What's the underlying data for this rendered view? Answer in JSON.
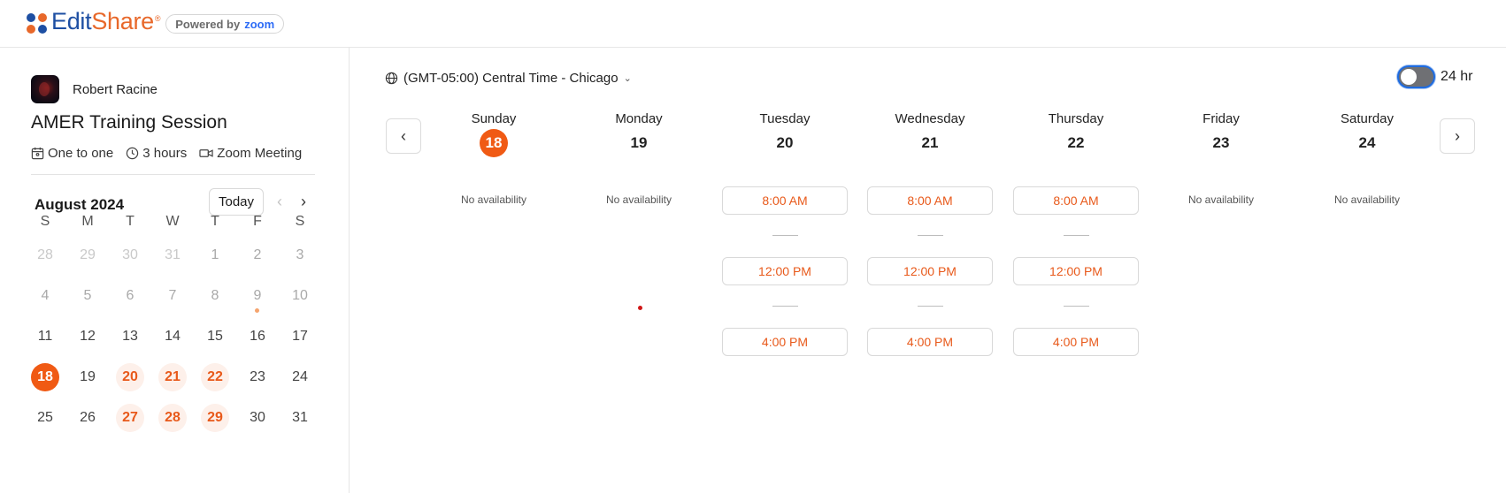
{
  "header": {
    "logo_edit": "Edit",
    "logo_share": "Share",
    "logo_reg": "®",
    "powered_by": "Powered by",
    "powered_brand": "zoom"
  },
  "event": {
    "host_name": "Robert Racine",
    "title": "AMER Training Session",
    "type": "One to one",
    "duration": "3 hours",
    "location": "Zoom Meeting"
  },
  "mini_calendar": {
    "month_label": "August 2024",
    "today_label": "Today",
    "weekday_headers": [
      "S",
      "M",
      "T",
      "W",
      "T",
      "F",
      "S"
    ],
    "weeks": [
      [
        "28",
        "29",
        "30",
        "31",
        "1",
        "2",
        "3"
      ],
      [
        "4",
        "5",
        "6",
        "7",
        "8",
        "9",
        "10"
      ],
      [
        "11",
        "12",
        "13",
        "14",
        "15",
        "16",
        "17"
      ],
      [
        "18",
        "19",
        "20",
        "21",
        "22",
        "23",
        "24"
      ],
      [
        "25",
        "26",
        "27",
        "28",
        "29",
        "30",
        "31"
      ]
    ]
  },
  "scheduler": {
    "timezone": "(GMT-05:00) Central Time - Chicago",
    "toggle_label": "24 hr",
    "toggle_on": false,
    "days": [
      {
        "name": "Sunday",
        "num": "18",
        "no_avail": "No availability"
      },
      {
        "name": "Monday",
        "num": "19",
        "no_avail": "No availability"
      },
      {
        "name": "Tuesday",
        "num": "20",
        "slots": [
          "8:00 AM",
          "12:00 PM",
          "4:00 PM"
        ]
      },
      {
        "name": "Wednesday",
        "num": "21",
        "slots": [
          "8:00 AM",
          "12:00 PM",
          "4:00 PM"
        ]
      },
      {
        "name": "Thursday",
        "num": "22",
        "slots": [
          "8:00 AM",
          "12:00 PM",
          "4:00 PM"
        ]
      },
      {
        "name": "Friday",
        "num": "23",
        "no_avail": "No availability"
      },
      {
        "name": "Saturday",
        "num": "24",
        "no_avail": "No availability"
      }
    ]
  },
  "colors": {
    "accent": "#f05a14",
    "brand_blue": "#1e4fa3",
    "brand_orange": "#e8682a"
  }
}
